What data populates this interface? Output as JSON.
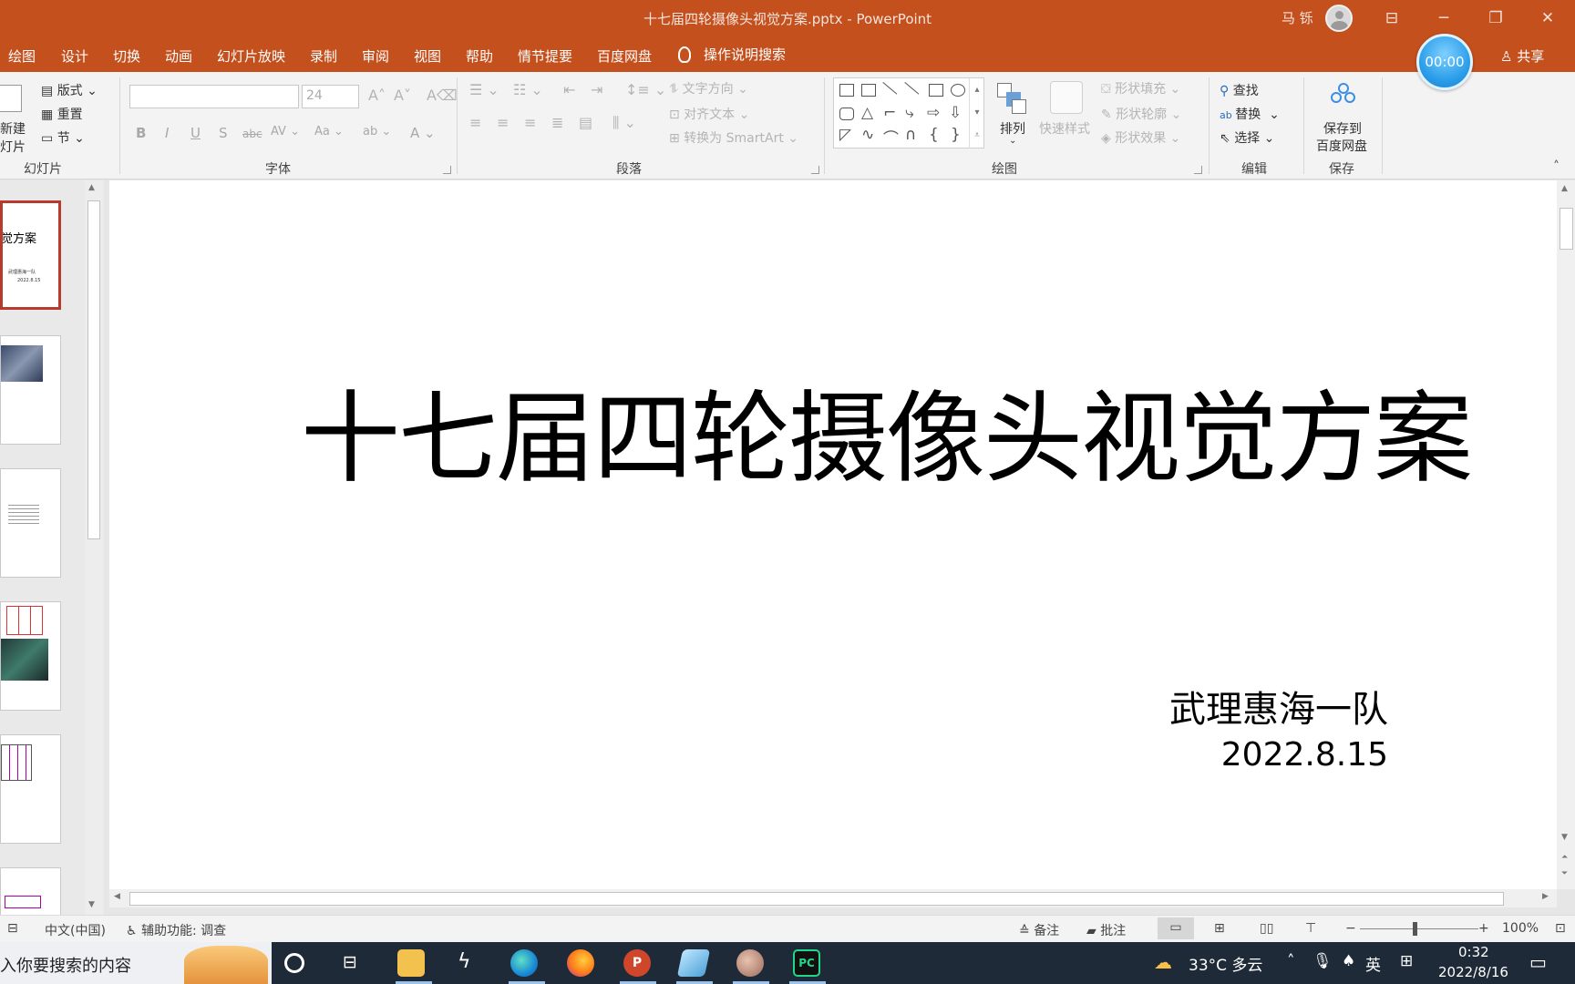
{
  "window": {
    "title": "十七届四轮摄像头视觉方案.pptx  -  PowerPoint",
    "user": "马 铄"
  },
  "menu": {
    "tabs": [
      "绘图",
      "设计",
      "切换",
      "动画",
      "幻灯片放映",
      "录制",
      "审阅",
      "视图",
      "帮助",
      "情节提要",
      "百度网盘"
    ],
    "tell_me": "操作说明搜索",
    "share": "共享",
    "timer": "00:00"
  },
  "ribbon": {
    "slides_group": {
      "new_slide_line1": "新建",
      "new_slide_line2": "灯片",
      "layout": "版式",
      "reset": "重置",
      "section": "节",
      "label": "幻灯片"
    },
    "font_group": {
      "font_size": "24",
      "label": "字体"
    },
    "paragraph_group": {
      "text_direction": "文字方向",
      "align_text": "对齐文本",
      "convert_smartart": "转换为 SmartArt",
      "label": "段落"
    },
    "drawing_group": {
      "arrange": "排列",
      "quick_styles": "快速样式",
      "shape_fill": "形状填充",
      "shape_outline": "形状轮廓",
      "shape_effects": "形状效果",
      "label": "绘图"
    },
    "editing_group": {
      "find": "查找",
      "replace": "替换",
      "select": "选择",
      "label": "编辑"
    },
    "save_group": {
      "save_to_line1": "保存到",
      "save_to_line2": "百度网盘",
      "label": "保存"
    }
  },
  "slide": {
    "title": "十七届四轮摄像头视觉方案",
    "team": "武理惠海一队",
    "date": "2022.8.15"
  },
  "thumbnails": {
    "first_title": "觉方案",
    "first_sub": "武理惠海一队",
    "first_date": "2022.8.15"
  },
  "status": {
    "language": "中文(中国)",
    "accessibility": "辅助功能: 调查",
    "notes": "备注",
    "comments": "批注",
    "zoom": "100%"
  },
  "taskbar": {
    "search_placeholder": "入你要搜索的内容",
    "weather": "33°C  多云",
    "ime": "英",
    "time": "0:32",
    "date": "2022/8/16"
  },
  "colors": {
    "accent": "#c4501e",
    "ribbon": "#f3f3f3",
    "taskbar": "#1f2a38",
    "selected_thumb": "#b73b2c"
  }
}
